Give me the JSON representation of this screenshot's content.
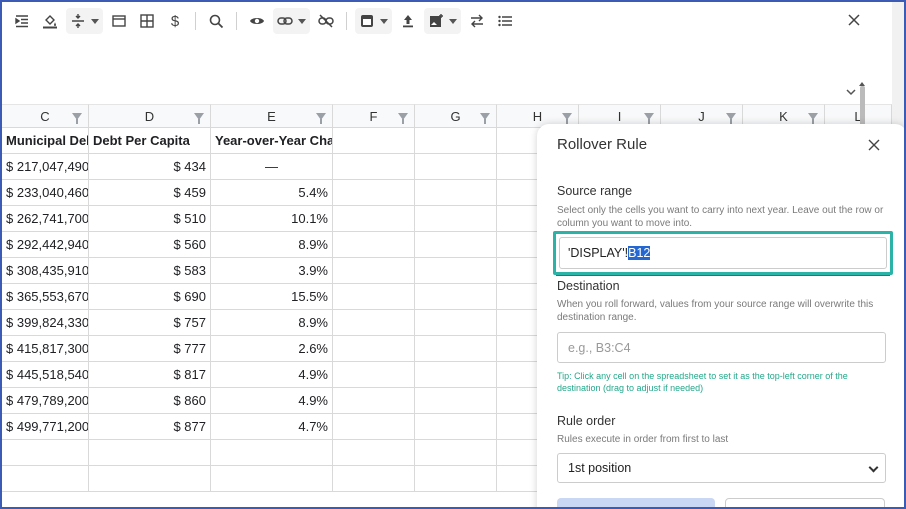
{
  "toolbar": {
    "icons": [
      "indent-icon",
      "fill-color-icon",
      "align-vertical-icon",
      "borders-icon",
      "table-icon",
      "currency-icon",
      "search-icon",
      "eye-icon",
      "link-icon",
      "unlink-icon",
      "insert-icon",
      "upload-icon",
      "image-icon",
      "swap-icon",
      "list-icon",
      "close-icon"
    ],
    "currency_symbol": "$"
  },
  "grid": {
    "columns": [
      "C",
      "D",
      "E",
      "F",
      "G",
      "H",
      "I",
      "J",
      "K",
      "L"
    ],
    "headers": [
      "Municipal Debt (",
      "Debt Per Capita",
      "Year-over-Year Chang"
    ],
    "rows": [
      [
        "$ 217,047,490",
        "$ 434",
        "—"
      ],
      [
        "$ 233,040,460",
        "$ 459",
        "5.4%"
      ],
      [
        "$ 262,741,700",
        "$ 510",
        "10.1%"
      ],
      [
        "$ 292,442,940",
        "$ 560",
        "8.9%"
      ],
      [
        "$ 308,435,910",
        "$ 583",
        "3.9%"
      ],
      [
        "$ 365,553,670",
        "$ 690",
        "15.5%"
      ],
      [
        "$ 399,824,330",
        "$ 757",
        "8.9%"
      ],
      [
        "$ 415,817,300",
        "$ 777",
        "2.6%"
      ],
      [
        "$ 445,518,540",
        "$ 817",
        "4.9%"
      ],
      [
        "$ 479,789,200",
        "$ 860",
        "4.9%"
      ],
      [
        "$ 499,771,200",
        "$ 877",
        "4.7%"
      ]
    ]
  },
  "panel": {
    "title": "Rollover Rule",
    "source": {
      "label": "Source range",
      "help": "Select only the cells you want to carry into next year. Leave out the row or column you want to move into.",
      "value_prefix": "'DISPLAY'!",
      "value_selected": "B12"
    },
    "destination": {
      "label": "Destination",
      "help": "When you roll forward, values from your source range will overwrite this destination range.",
      "placeholder": "e.g., B3:C4",
      "tip": "Tip: Click any cell on the spreadsheet to set it as the top-left corner of the destination (drag to adjust if needed)"
    },
    "rule_order": {
      "label": "Rule order",
      "help": "Rules execute in order from first to last",
      "selected": "1st position"
    }
  },
  "colors": {
    "accent": "#2566d0",
    "focus": "#2bb3a7",
    "tip": "#23a88a",
    "frame": "#3b5bb5"
  }
}
